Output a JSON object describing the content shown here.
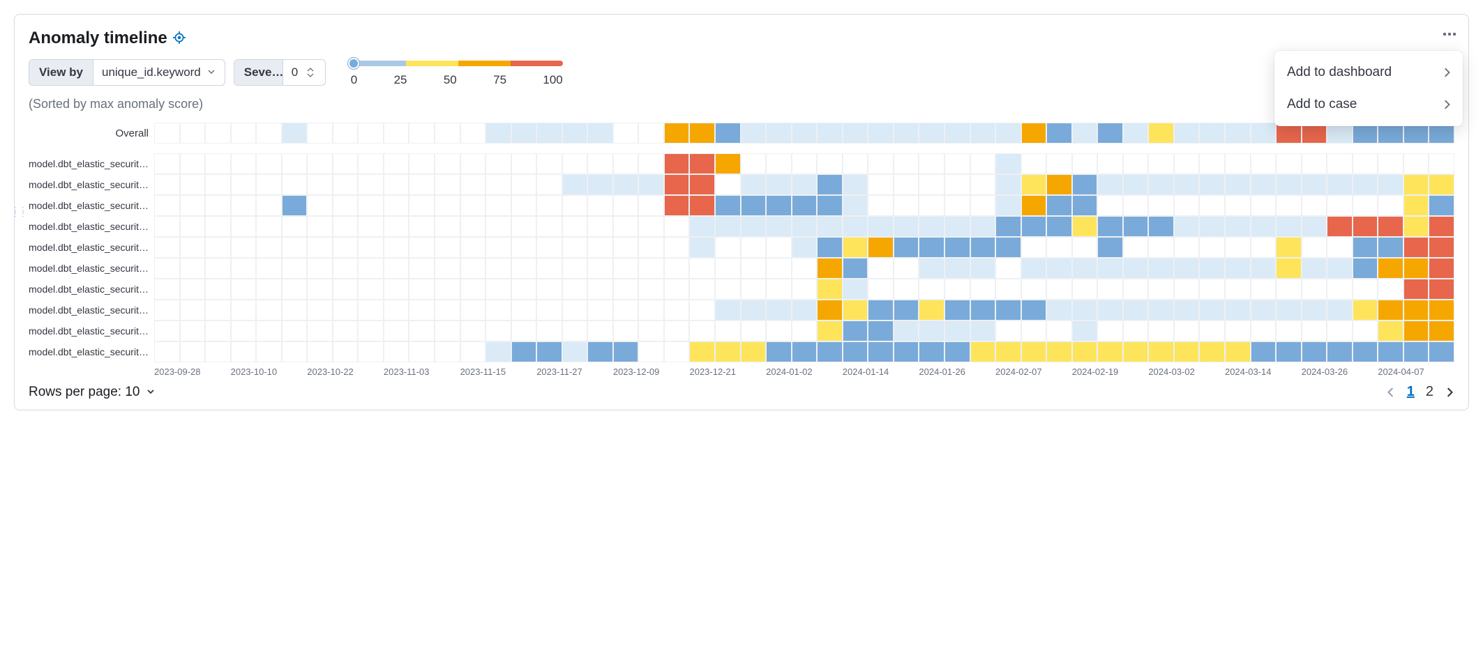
{
  "title": "Anomaly timeline",
  "controls": {
    "viewby_label": "View by",
    "viewby_value": "unique_id.keyword",
    "severity_label": "Seve…",
    "severity_value": "0"
  },
  "legend": {
    "ticks": [
      "0",
      "25",
      "50",
      "75",
      "100"
    ]
  },
  "sort_note": "(Sorted by max anomaly score)",
  "menu": {
    "add_dashboard": "Add to dashboard",
    "add_case": "Add to case"
  },
  "footer": {
    "rows_label": "Rows per page: 10"
  },
  "pagination": {
    "current": "1",
    "other": "2"
  },
  "chart_data": {
    "type": "heatmap",
    "title": "Anomaly timeline",
    "xlabel": "",
    "ylabel": "",
    "legend_scale": [
      0,
      25,
      50,
      75,
      100
    ],
    "levels": {
      "none": null,
      "vlow": 5,
      "low": 30,
      "med": 45,
      "high": 65,
      "crit": 90
    },
    "x_ticks": [
      "2023-09-28",
      "2023-10-10",
      "2023-10-22",
      "2023-11-03",
      "2023-11-15",
      "2023-11-27",
      "2023-12-09",
      "2023-12-21",
      "2024-01-02",
      "2024-01-14",
      "2024-01-26",
      "2024-02-07",
      "2024-02-19",
      "2024-03-02",
      "2024-03-14",
      "2024-03-26",
      "2024-04-07"
    ],
    "n_cols": 51,
    "overall": {
      "label": "Overall",
      "cells": [
        "none",
        "none",
        "none",
        "none",
        "none",
        "vlow",
        "none",
        "none",
        "none",
        "none",
        "none",
        "none",
        "none",
        "vlow",
        "vlow",
        "vlow",
        "vlow",
        "vlow",
        "none",
        "none",
        "high",
        "high",
        "low",
        "vlow",
        "vlow",
        "vlow",
        "vlow",
        "vlow",
        "vlow",
        "vlow",
        "vlow",
        "vlow",
        "vlow",
        "vlow",
        "high",
        "low",
        "vlow",
        "low",
        "vlow",
        "med",
        "vlow",
        "vlow",
        "vlow",
        "vlow",
        "crit",
        "crit",
        "vlow",
        "low",
        "low",
        "low",
        "low"
      ]
    },
    "rows": [
      {
        "label": "model.dbt_elastic_security…",
        "cells": [
          "none",
          "none",
          "none",
          "none",
          "none",
          "none",
          "none",
          "none",
          "none",
          "none",
          "none",
          "none",
          "none",
          "none",
          "none",
          "none",
          "none",
          "none",
          "none",
          "none",
          "crit",
          "crit",
          "high",
          "none",
          "none",
          "none",
          "none",
          "none",
          "none",
          "none",
          "none",
          "none",
          "none",
          "vlow",
          "none",
          "none",
          "none",
          "none",
          "none",
          "none",
          "none",
          "none",
          "none",
          "none",
          "none",
          "none",
          "none",
          "none",
          "none",
          "none",
          "none"
        ]
      },
      {
        "label": "model.dbt_elastic_security…",
        "cells": [
          "none",
          "none",
          "none",
          "none",
          "none",
          "none",
          "none",
          "none",
          "none",
          "none",
          "none",
          "none",
          "none",
          "none",
          "none",
          "none",
          "vlow",
          "vlow",
          "vlow",
          "vlow",
          "crit",
          "crit",
          "none",
          "vlow",
          "vlow",
          "vlow",
          "low",
          "vlow",
          "none",
          "none",
          "none",
          "none",
          "none",
          "vlow",
          "med",
          "high",
          "low",
          "vlow",
          "vlow",
          "vlow",
          "vlow",
          "vlow",
          "vlow",
          "vlow",
          "vlow",
          "vlow",
          "vlow",
          "vlow",
          "vlow",
          "med",
          "med"
        ]
      },
      {
        "label": "model.dbt_elastic_security…",
        "cells": [
          "none",
          "none",
          "none",
          "none",
          "none",
          "low",
          "none",
          "none",
          "none",
          "none",
          "none",
          "none",
          "none",
          "none",
          "none",
          "none",
          "none",
          "none",
          "none",
          "none",
          "crit",
          "crit",
          "low",
          "low",
          "low",
          "low",
          "low",
          "vlow",
          "none",
          "none",
          "none",
          "none",
          "none",
          "vlow",
          "high",
          "low",
          "low",
          "none",
          "none",
          "none",
          "none",
          "none",
          "none",
          "none",
          "none",
          "none",
          "none",
          "none",
          "none",
          "med",
          "low"
        ]
      },
      {
        "label": "model.dbt_elastic_security…",
        "cells": [
          "none",
          "none",
          "none",
          "none",
          "none",
          "none",
          "none",
          "none",
          "none",
          "none",
          "none",
          "none",
          "none",
          "none",
          "none",
          "none",
          "none",
          "none",
          "none",
          "none",
          "none",
          "vlow",
          "vlow",
          "vlow",
          "vlow",
          "vlow",
          "vlow",
          "vlow",
          "vlow",
          "vlow",
          "vlow",
          "vlow",
          "vlow",
          "low",
          "low",
          "low",
          "med",
          "low",
          "low",
          "low",
          "vlow",
          "vlow",
          "vlow",
          "vlow",
          "vlow",
          "vlow",
          "crit",
          "crit",
          "crit",
          "med",
          "crit"
        ]
      },
      {
        "label": "model.dbt_elastic_security…",
        "cells": [
          "none",
          "none",
          "none",
          "none",
          "none",
          "none",
          "none",
          "none",
          "none",
          "none",
          "none",
          "none",
          "none",
          "none",
          "none",
          "none",
          "none",
          "none",
          "none",
          "none",
          "none",
          "vlow",
          "none",
          "none",
          "none",
          "vlow",
          "low",
          "med",
          "high",
          "low",
          "low",
          "low",
          "low",
          "low",
          "none",
          "none",
          "none",
          "low",
          "none",
          "none",
          "none",
          "none",
          "none",
          "none",
          "med",
          "none",
          "none",
          "low",
          "low",
          "crit",
          "crit"
        ]
      },
      {
        "label": "model.dbt_elastic_security…",
        "cells": [
          "none",
          "none",
          "none",
          "none",
          "none",
          "none",
          "none",
          "none",
          "none",
          "none",
          "none",
          "none",
          "none",
          "none",
          "none",
          "none",
          "none",
          "none",
          "none",
          "none",
          "none",
          "none",
          "none",
          "none",
          "none",
          "none",
          "high",
          "low",
          "none",
          "none",
          "vlow",
          "vlow",
          "vlow",
          "none",
          "vlow",
          "vlow",
          "vlow",
          "vlow",
          "vlow",
          "vlow",
          "vlow",
          "vlow",
          "vlow",
          "vlow",
          "med",
          "vlow",
          "vlow",
          "low",
          "high",
          "high",
          "crit"
        ]
      },
      {
        "label": "model.dbt_elastic_security…",
        "cells": [
          "none",
          "none",
          "none",
          "none",
          "none",
          "none",
          "none",
          "none",
          "none",
          "none",
          "none",
          "none",
          "none",
          "none",
          "none",
          "none",
          "none",
          "none",
          "none",
          "none",
          "none",
          "none",
          "none",
          "none",
          "none",
          "none",
          "med",
          "vlow",
          "none",
          "none",
          "none",
          "none",
          "none",
          "none",
          "none",
          "none",
          "none",
          "none",
          "none",
          "none",
          "none",
          "none",
          "none",
          "none",
          "none",
          "none",
          "none",
          "none",
          "none",
          "crit",
          "crit"
        ]
      },
      {
        "label": "model.dbt_elastic_security…",
        "cells": [
          "none",
          "none",
          "none",
          "none",
          "none",
          "none",
          "none",
          "none",
          "none",
          "none",
          "none",
          "none",
          "none",
          "none",
          "none",
          "none",
          "none",
          "none",
          "none",
          "none",
          "none",
          "none",
          "vlow",
          "vlow",
          "vlow",
          "vlow",
          "high",
          "med",
          "low",
          "low",
          "med",
          "low",
          "low",
          "low",
          "low",
          "vlow",
          "vlow",
          "vlow",
          "vlow",
          "vlow",
          "vlow",
          "vlow",
          "vlow",
          "vlow",
          "vlow",
          "vlow",
          "vlow",
          "med",
          "high",
          "high",
          "high"
        ]
      },
      {
        "label": "model.dbt_elastic_security…",
        "cells": [
          "none",
          "none",
          "none",
          "none",
          "none",
          "none",
          "none",
          "none",
          "none",
          "none",
          "none",
          "none",
          "none",
          "none",
          "none",
          "none",
          "none",
          "none",
          "none",
          "none",
          "none",
          "none",
          "none",
          "none",
          "none",
          "none",
          "med",
          "low",
          "low",
          "vlow",
          "vlow",
          "vlow",
          "vlow",
          "none",
          "none",
          "none",
          "vlow",
          "none",
          "none",
          "none",
          "none",
          "none",
          "none",
          "none",
          "none",
          "none",
          "none",
          "none",
          "med",
          "high",
          "high"
        ]
      },
      {
        "label": "model.dbt_elastic_security…",
        "cells": [
          "none",
          "none",
          "none",
          "none",
          "none",
          "none",
          "none",
          "none",
          "none",
          "none",
          "none",
          "none",
          "none",
          "vlow",
          "low",
          "low",
          "vlow",
          "low",
          "low",
          "none",
          "none",
          "med",
          "med",
          "med",
          "low",
          "low",
          "low",
          "low",
          "low",
          "low",
          "low",
          "low",
          "med",
          "med",
          "med",
          "med",
          "med",
          "med",
          "med",
          "med",
          "med",
          "med",
          "med",
          "low",
          "low",
          "low",
          "low",
          "low",
          "low",
          "low",
          "low"
        ]
      }
    ]
  }
}
